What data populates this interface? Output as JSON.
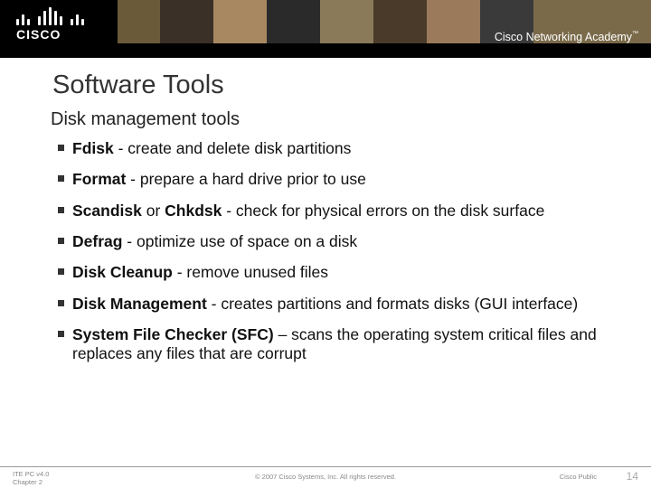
{
  "header": {
    "logo_text": "CISCO",
    "academy": "Cisco Networking Academy",
    "tm": "™"
  },
  "slide": {
    "title": "Software Tools",
    "subtitle": "Disk management tools",
    "bullets": [
      {
        "bold": "Fdisk",
        "rest": " - create and delete disk partitions"
      },
      {
        "bold": "Format",
        "rest": " - prepare a hard drive prior to use"
      },
      {
        "html": "<span class=\"b\">Scandisk</span> or <span class=\"b\">Chkdsk</span> - check for physical errors on the disk surface"
      },
      {
        "bold": "Defrag",
        "rest": " - optimize use of space on a disk"
      },
      {
        "bold": "Disk Cleanup",
        "rest": " - remove unused files"
      },
      {
        "bold": "Disk Management",
        "rest": " - creates partitions and formats disks (GUI interface)"
      },
      {
        "bold": "System File Checker (SFC)",
        "rest": " –  scans the operating system critical files and replaces any files that are corrupt"
      }
    ]
  },
  "footer": {
    "left_line1": "ITE PC v4.0",
    "left_line2": "Chapter 2",
    "center": "© 2007 Cisco Systems, Inc. All rights reserved.",
    "right1": "Cisco Public",
    "page": "14"
  }
}
